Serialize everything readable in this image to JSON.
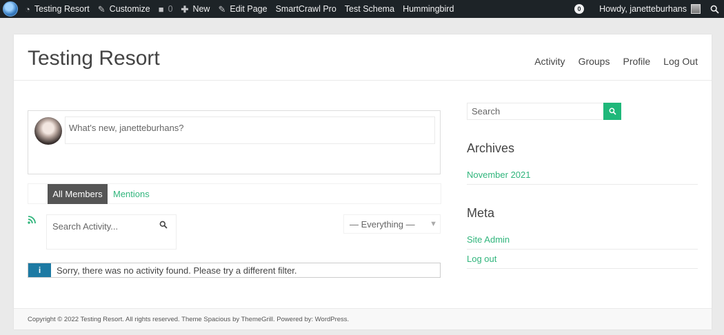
{
  "adminbar": {
    "items": [
      {
        "icon": "dashboard-icon",
        "label": "Testing Resort"
      },
      {
        "icon": "brush-icon",
        "label": "Customize"
      },
      {
        "icon": "comment-icon",
        "label": "0"
      },
      {
        "icon": "plus-icon",
        "label": "New"
      },
      {
        "icon": "pencil-icon",
        "label": "Edit Page"
      },
      {
        "label": "SmartCrawl Pro"
      },
      {
        "label": "Test Schema"
      },
      {
        "label": "Hummingbird"
      }
    ],
    "notification_count": "0",
    "howdy": "Howdy, janetteburhans"
  },
  "header": {
    "site_title": "Testing Resort",
    "nav": [
      "Activity",
      "Groups",
      "Profile",
      "Log Out"
    ]
  },
  "activity": {
    "whats_new_placeholder": "What's new, janetteburhans?",
    "tabs": {
      "all_members": "All Members",
      "mentions": "Mentions"
    },
    "search_placeholder": "Search Activity...",
    "filter_selected": "— Everything —",
    "notice": "Sorry, there was no activity found. Please try a different filter."
  },
  "sidebar": {
    "search_placeholder": "Search",
    "archives_heading": "Archives",
    "archives": [
      "November 2021"
    ],
    "meta_heading": "Meta",
    "meta_links": [
      "Site Admin",
      "Log out"
    ]
  },
  "footer": {
    "text": "Copyright © 2022 Testing Resort. All rights reserved. Theme Spacious by ThemeGrill. Powered by: WordPress."
  },
  "colors": {
    "accent": "#30b57c",
    "adminbar_bg": "#1d2327",
    "notice_icon_bg": "#1d7aa3",
    "active_tab_bg": "#555555"
  }
}
